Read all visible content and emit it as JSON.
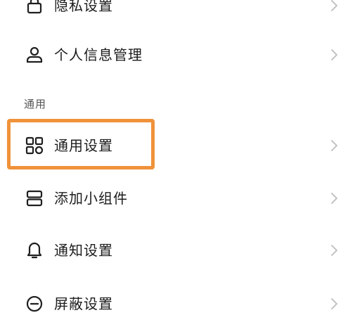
{
  "list": {
    "items": [
      {
        "label": "隐私设置",
        "icon": "privacy-icon"
      },
      {
        "label": "个人信息管理",
        "icon": "user-icon"
      },
      {
        "label": "通用设置",
        "icon": "grid-icon"
      },
      {
        "label": "添加小组件",
        "icon": "widget-icon"
      },
      {
        "label": "通知设置",
        "icon": "bell-icon"
      },
      {
        "label": "屏蔽设置",
        "icon": "block-icon"
      }
    ],
    "section_general": "通用"
  },
  "colors": {
    "highlight": "#f0923a",
    "icon": "#1f1f1f",
    "chevron": "#bdbdbd",
    "section_text": "#555555"
  }
}
